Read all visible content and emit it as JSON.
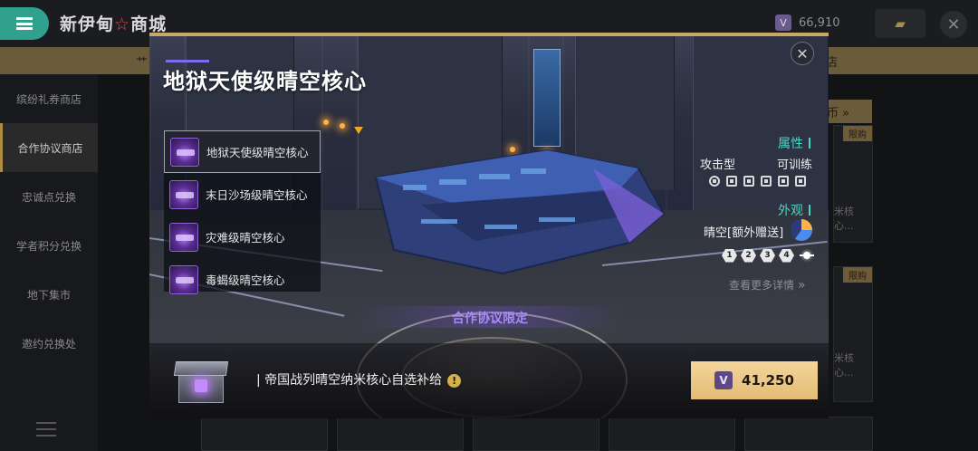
{
  "header": {
    "shop_title_part1": "新伊甸",
    "shop_title_star": "☆",
    "shop_title_part2": "商城",
    "currency_amount": "66,910",
    "currency_icon": "crest-icon"
  },
  "tabs": {
    "left_tab": "艹",
    "right_tab": "店"
  },
  "sidebar": {
    "items": [
      {
        "label": "缤纷礼券商店"
      },
      {
        "label": "合作协议商店"
      },
      {
        "label": "忠诚点兑换"
      },
      {
        "label": "学者积分兑换"
      },
      {
        "label": "地下集市"
      },
      {
        "label": "邀约兑换处"
      }
    ],
    "active_index": 1
  },
  "background_cards": {
    "gold_bar_label": "币",
    "tag_label": "限购",
    "card_text_1": "米核心...",
    "card_text_2": "米核心..."
  },
  "modal": {
    "title": "地狱天使级晴空核心",
    "close_label": "✕",
    "core_list": [
      {
        "label": "地狱天使级晴空核心",
        "selected": true
      },
      {
        "label": "末日沙场级晴空核心",
        "selected": false
      },
      {
        "label": "灾难级晴空核心",
        "selected": false
      },
      {
        "label": "毒蝎级晴空核心",
        "selected": false
      }
    ],
    "attributes": {
      "section_title": "属性",
      "type": "攻击型",
      "trainable": "可训练"
    },
    "appearance": {
      "section_title": "外观",
      "name": "晴空[额外赠送]",
      "levels": [
        "1",
        "2",
        "3",
        "4"
      ]
    },
    "more_details": "查看更多详情",
    "limited_label": "合作协议限定",
    "supply": {
      "name": "| 帝国战列晴空纳米核心自选补给",
      "info_icon": "!"
    },
    "buy_button": {
      "price": "41,250",
      "icon": "crest-icon"
    }
  },
  "colors": {
    "accent_teal": "#47d6c6",
    "accent_purple": "#a98cf5",
    "gold": "#e3bd76",
    "menu_green": "#2fa18c"
  }
}
